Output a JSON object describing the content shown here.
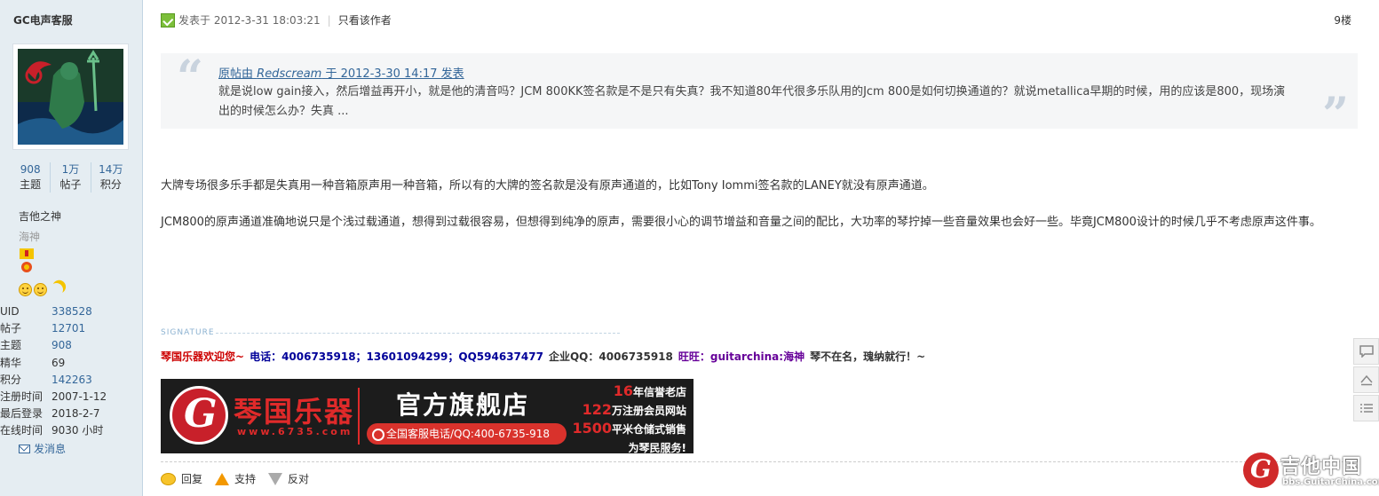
{
  "sidebar": {
    "author": "GC电声客服",
    "stats": [
      {
        "num": "908",
        "label": "主题"
      },
      {
        "num": "1万",
        "label": "帖子"
      },
      {
        "num": "14万",
        "label": "积分"
      }
    ],
    "title1": "吉他之神",
    "title2": "海神",
    "info": [
      {
        "key": "UID",
        "value": "338528",
        "link": true
      },
      {
        "key": "帖子",
        "value": "12701",
        "link": true
      },
      {
        "key": "主题",
        "value": "908",
        "link": true
      },
      {
        "key": "精华",
        "value": "69",
        "link": false
      },
      {
        "key": "积分",
        "value": "142263",
        "link": true
      },
      {
        "key": "注册时间",
        "value": "2007-1-12",
        "link": false
      },
      {
        "key": "最后登录",
        "value": "2018-2-7",
        "link": false
      },
      {
        "key": "在线时间",
        "value": "9030 小时",
        "link": false
      }
    ],
    "pm": "发消息"
  },
  "post": {
    "posted_at": "发表于 2012-3-31 18:03:21",
    "only_author": "只看该作者",
    "floor": "9楼",
    "quote": {
      "prefix": "原帖由",
      "user": "Redscream",
      "suffix": "于 2012-3-30 14:17 发表",
      "body": "就是说low gain接入，然后增益再开小，就是他的清音吗？JCM 800KK签名款是不是只有失真？我不知道80年代很多乐队用的Jcm 800是如何切换通道的？就说metallica早期的时候，用的应该是800，现场演出的时候怎么办？失真 ..."
    },
    "paragraph1": "大牌专场很多乐手都是失真用一种音箱原声用一种音箱，所以有的大牌的签名款是没有原声通道的，比如Tony Iommi签名款的LANEY就没有原声通道。",
    "paragraph2": "JCM800的原声通道准确地说只是个浅过载通道，想得到过载很容易，但想得到纯净的原声，需要很小心的调节增益和音量之间的配比，大功率的琴拧掉一些音量效果也会好一些。毕竟JCM800设计的时候几乎不考虑原声这件事。"
  },
  "signature": {
    "label": "SIGNATURE",
    "parts": [
      {
        "text": "琴国乐器欢迎您~",
        "color": "#cc0000"
      },
      {
        "text": "电话：4006735918；13601094299；QQ594637477",
        "color": "#000099"
      },
      {
        "text": "企业QQ：4006735918",
        "color": "#333333"
      },
      {
        "text": "旺旺：guitarchina:海神",
        "color": "#660099"
      },
      {
        "text": "琴不在名，瑰纳就行！~",
        "color": "#333333"
      }
    ]
  },
  "banner": {
    "name": "琴国乐器",
    "url": "www.6735.com",
    "title": "官方旗舰店",
    "phone": "全国客服电话/QQ:400-6735-918",
    "stats": [
      {
        "num": "16",
        "text": "年信誉老店"
      },
      {
        "num": "122",
        "text": "万注册会员网站"
      },
      {
        "num": "1500",
        "text": "平米仓储式销售"
      },
      {
        "num": "",
        "text": "为琴民服务!"
      }
    ]
  },
  "actions": {
    "reply": "回复",
    "support": "支持",
    "oppose": "反对"
  },
  "watermark": {
    "title": "吉他中国",
    "url": "bbs.GuitarChina.com"
  },
  "icons": {
    "tool1": "comment-icon",
    "tool2": "back-to-top-icon",
    "tool3": "list-icon"
  }
}
